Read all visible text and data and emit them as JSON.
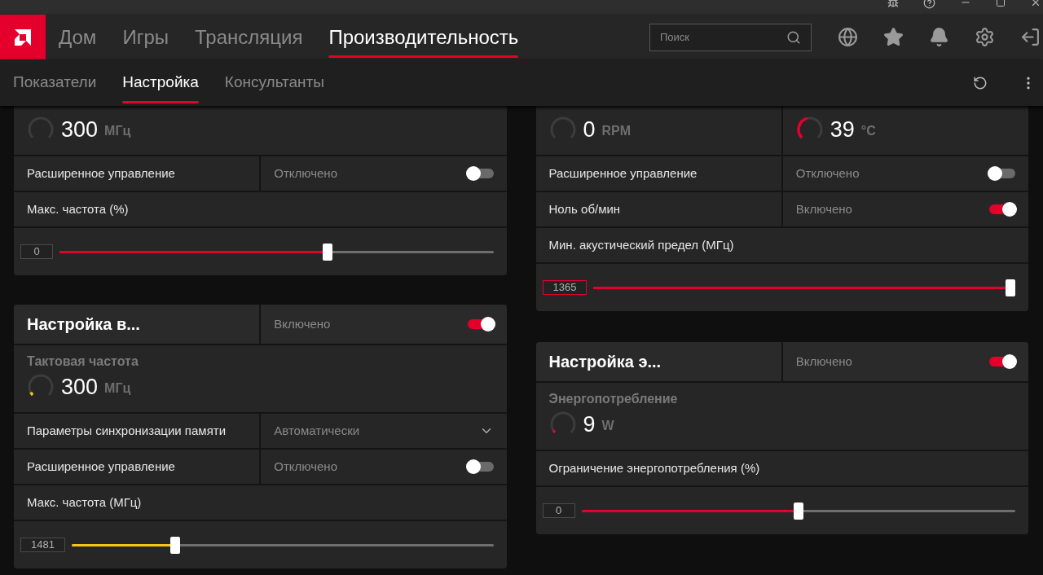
{
  "nav": {
    "tabs": [
      {
        "label": "Дом",
        "selected": false
      },
      {
        "label": "Игры",
        "selected": false
      },
      {
        "label": "Трансляция",
        "selected": false
      },
      {
        "label": "Производительность",
        "selected": true
      }
    ],
    "search": {
      "placeholder": "Поиск"
    }
  },
  "subtabs": [
    {
      "label": "Показатели",
      "selected": false
    },
    {
      "label": "Настройка",
      "selected": true
    },
    {
      "label": "Консультанты",
      "selected": false
    }
  ],
  "columns": [
    {
      "cards": [
        {
          "rows": [
            {
              "kind": "gauges",
              "items": [
                {
                  "value": "300",
                  "unit": "МГц"
                }
              ]
            },
            {
              "kind": "toggle",
              "label": "Расширенное управление",
              "status": "Отключено",
              "on": false
            },
            {
              "kind": "label",
              "label": "Макс. частота (%)"
            },
            {
              "kind": "slider",
              "value": "0",
              "level": 0.62,
              "color": "#e4002b",
              "highlighted": false
            }
          ]
        },
        {
          "header": {
            "title": "Настройка в...",
            "status": "Включено",
            "on": true
          },
          "rows": [
            {
              "kind": "gauges",
              "items": [
                {
                  "label": "Тактовая частота",
                  "value": "300",
                  "unit": "МГц",
                  "level": 0.06,
                  "color": "#f5c518"
                }
              ]
            },
            {
              "kind": "dropdown",
              "label": "Параметры синхронизации памяти",
              "value": "Автоматически"
            },
            {
              "kind": "toggle",
              "label": "Расширенное управление",
              "status": "Отключено",
              "on": false
            },
            {
              "kind": "label",
              "label": "Макс. частота (МГц)"
            },
            {
              "kind": "slider",
              "value": "1481",
              "level": 0.24,
              "color": "#f5c518",
              "highlighted": false
            }
          ]
        }
      ]
    },
    {
      "cards": [
        {
          "rows": [
            {
              "kind": "gauges",
              "items": [
                {
                  "value": "0",
                  "unit": "RPM"
                },
                {
                  "value": "39",
                  "unit": "°C",
                  "level": 0.45,
                  "color": "#e4002b"
                }
              ]
            },
            {
              "kind": "toggle",
              "label": "Расширенное управление",
              "status": "Отключено",
              "on": false
            },
            {
              "kind": "toggle",
              "label": "Ноль об/мин",
              "status": "Включено",
              "on": true
            },
            {
              "kind": "label",
              "label": "Мин. акустический предел (МГц)"
            },
            {
              "kind": "slider",
              "value": "1365",
              "level": 1,
              "color": "#e4002b",
              "highlighted": true
            }
          ]
        },
        {
          "header": {
            "title": "Настройка э...",
            "status": "Включено",
            "on": true
          },
          "rows": [
            {
              "kind": "gauges",
              "items": [
                {
                  "label": "Энергопотребление",
                  "value": "9",
                  "unit": "W",
                  "level": 0.05,
                  "color": "#e4002b"
                }
              ]
            },
            {
              "kind": "label",
              "label": "Ограничение энергопотребления (%)"
            },
            {
              "kind": "slider",
              "value": "0",
              "level": 0.5,
              "color": "#e4002b",
              "highlighted": false
            }
          ]
        }
      ]
    }
  ]
}
